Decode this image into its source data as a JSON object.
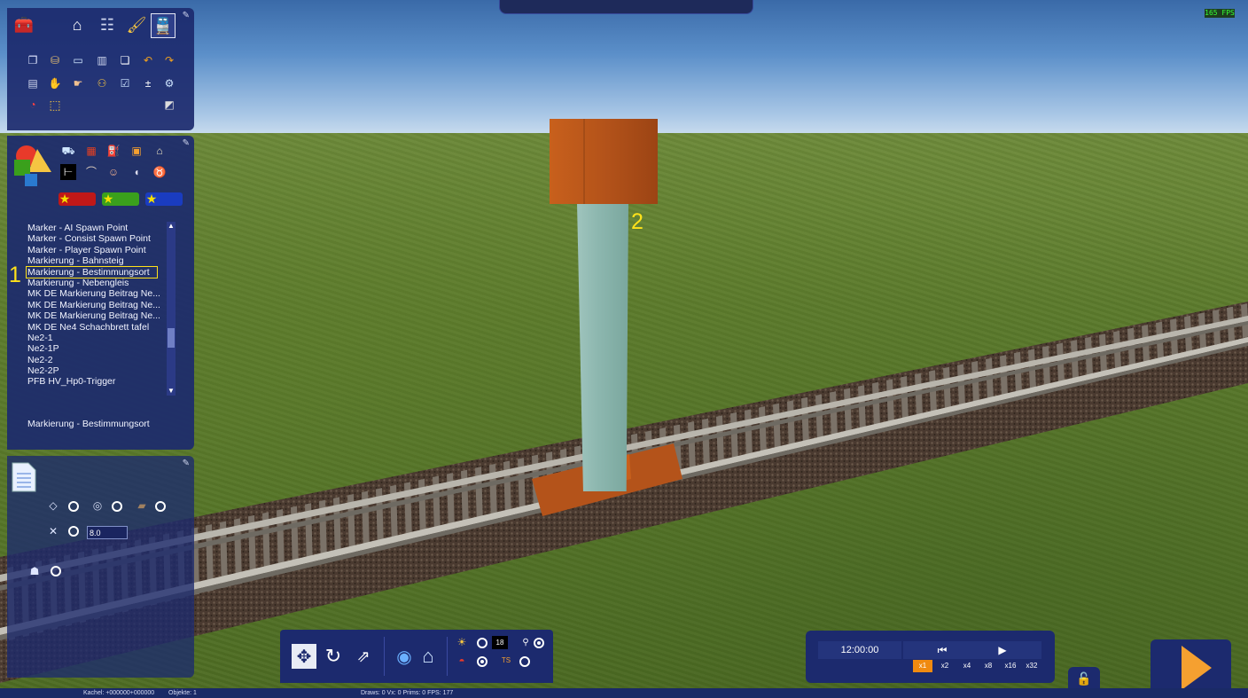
{
  "viewport": {
    "fps_label": "165 FPS",
    "marker_number_label": "2",
    "selection_number_label": "1"
  },
  "tools_panel": {
    "tabs": [
      "toolbox-icon",
      "home-icon",
      "track-icon",
      "paint-brush-icon",
      "train-icon"
    ],
    "active_tab": "train-icon",
    "tools_row1": [
      "copy-icon",
      "bucket-icon",
      "monitor-icon",
      "trash-icon",
      "scroll-icon",
      "undo-icon",
      "redo-icon"
    ],
    "tools_row2": [
      "rolling-stock-icon",
      "hand-icon",
      "pointer-icon",
      "people-icon",
      "check-icon",
      "add-marker-icon",
      "settings-icon"
    ],
    "tools_row3": [
      "pie-chart-icon",
      "selection-rect-icon",
      "eraser-icon"
    ]
  },
  "object_browser": {
    "category_row1": [
      "truck-icon",
      "wagon-icon",
      "locomotive-icon",
      "tram-icon",
      "building-icon"
    ],
    "category_row2": [
      "signal-icon",
      "bridge-icon",
      "figure-icon",
      "speaker-icon",
      "bag-icon"
    ],
    "favorites": [
      {
        "name": "red-favorite",
        "color": "#c01818"
      },
      {
        "name": "green-favorite",
        "color": "#3aa01c"
      },
      {
        "name": "blue-favorite",
        "color": "#1a3cc0"
      }
    ],
    "items": [
      "Marker - AI Spawn Point",
      "Marker - Consist Spawn Point",
      "Marker - Player Spawn Point",
      "Markierung - Bahnsteig",
      "Markierung - Bestimmungsort",
      "Markierung - Nebengleis",
      "MK DE Markierung Beitrag Ne...",
      "MK DE Markierung Beitrag Ne...",
      "MK DE Markierung Beitrag Ne...",
      "MK DE Ne4 Schachbrett tafel",
      "Ne2-1",
      "Ne2-1P",
      "Ne2-2",
      "Ne2-2P",
      "PFB HV_Hp0-Trigger"
    ],
    "selected_index": 4,
    "selected_name": "Markierung - Bestimmungsort"
  },
  "properties_panel": {
    "doc_icon": "document-icon",
    "value_field": "8.0"
  },
  "bottom_toolbar": {
    "time_value": "18"
  },
  "time_controls": {
    "clock": "12:00:00",
    "speeds": [
      "x1",
      "x2",
      "x4",
      "x8",
      "x16",
      "x32"
    ],
    "active_speed": "x1",
    "accent_color": "#f08a10"
  },
  "status_bar": {
    "tile": "Kachel: +000000+000000",
    "objects": "Objekte: 1",
    "stats": "Draws: 0 Vx: 0 Prims: 0 FPS: 177"
  }
}
